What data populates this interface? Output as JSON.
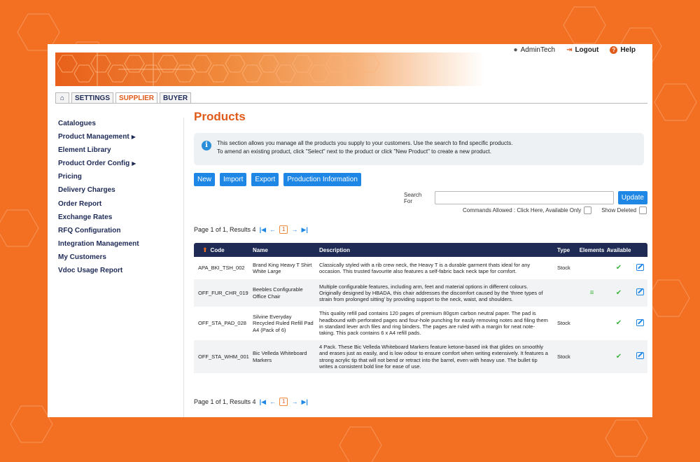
{
  "topbar": {
    "user": "AdminTech",
    "logout": "Logout",
    "help": "Help"
  },
  "tabs": {
    "home_icon": "home-icon",
    "settings": "SETTINGS",
    "supplier": "SUPPLIER",
    "buyer": "BUYER"
  },
  "sidebar": {
    "items": [
      {
        "label": "Catalogues",
        "arrow": ""
      },
      {
        "label": "Product Management",
        "arrow": "▶"
      },
      {
        "label": "Element Library",
        "arrow": ""
      },
      {
        "label": "Product Order Config",
        "arrow": "▶"
      },
      {
        "label": "Pricing",
        "arrow": ""
      },
      {
        "label": "Delivery Charges",
        "arrow": ""
      },
      {
        "label": "Order Report",
        "arrow": ""
      },
      {
        "label": "Exchange Rates",
        "arrow": ""
      },
      {
        "label": "RFQ Configuration",
        "arrow": ""
      },
      {
        "label": "Integration Management",
        "arrow": ""
      },
      {
        "label": "My Customers",
        "arrow": ""
      },
      {
        "label": "Vdoc Usage Report",
        "arrow": ""
      }
    ]
  },
  "main": {
    "title": "Products",
    "info_line1": "This section allows you manage all the products you supply to your customers. Use the search to find specific products.",
    "info_line2": "To amend an existing product, click \"Select\" next to the product or click \"New Product\" to create a new product.",
    "buttons": {
      "new": "New",
      "import": "Import",
      "export": "Export",
      "production": "Production Information"
    },
    "search_label": "Search For",
    "search_value": "",
    "update": "Update",
    "commands_allowed": "Commands Allowed : Click Here, Available Only",
    "show_deleted": "Show Deleted",
    "pager_text": "Page 1 of 1, Results 4",
    "current_page": "1"
  },
  "table": {
    "headers": {
      "code": "Code",
      "name": "Name",
      "description": "Description",
      "type": "Type",
      "elements": "Elements",
      "available": "Available"
    },
    "rows": [
      {
        "code": "APA_BKI_TSH_002",
        "name": "Brand King Heavy T Shirt White Large",
        "description": "Classically styled with a rib crew neck, the Heavy T is a durable garment thats ideal for any occasion. This trusted favourite also features a self-fabric back neck tape for comfort.",
        "type": "Stock",
        "elements": "",
        "available": "✔"
      },
      {
        "code": "OFF_FUR_CHR_019",
        "name": "Beebles Configurable Office Chair",
        "description": "Multiple configurable features, including arm, feet and material options in different colours. Originally designed by HBADA, this chair addresses the discomfort caused by the 'three types of strain from prolonged sitting' by providing support to the neck, waist, and shoulders.",
        "type": "",
        "elements": "≡",
        "available": "✔"
      },
      {
        "code": "OFF_STA_PAD_028",
        "name": "Silvine Everyday Recycled Ruled Refill Pad A4 (Pack of 6)",
        "description": "This quality refill pad contains 120 pages of premium 80gsm carbon neutral paper. The pad is headbound with perforated pages and four-hole punching for easily removing notes and filing them in standard lever arch files and ring binders. The pages are ruled with a margin for neat note-taking. This pack contains 6 x A4 refill pads.",
        "type": "Stock",
        "elements": "",
        "available": "✔"
      },
      {
        "code": "OFF_STA_WHM_001",
        "name": "Bic Velleda Whiteboard Markers",
        "description": "4 Pack. These Bic Velleda Whiteboard Markers feature ketone-based ink that glides on smoothly and erases just as easily, and is low odour to ensure comfort when writing extensively. It features a strong acrylic tip that will not bend or retract into the barrel, even with heavy use. The bullet tip writes a consistent bold line for ease of use.",
        "type": "Stock",
        "elements": "",
        "available": "✔"
      }
    ]
  }
}
